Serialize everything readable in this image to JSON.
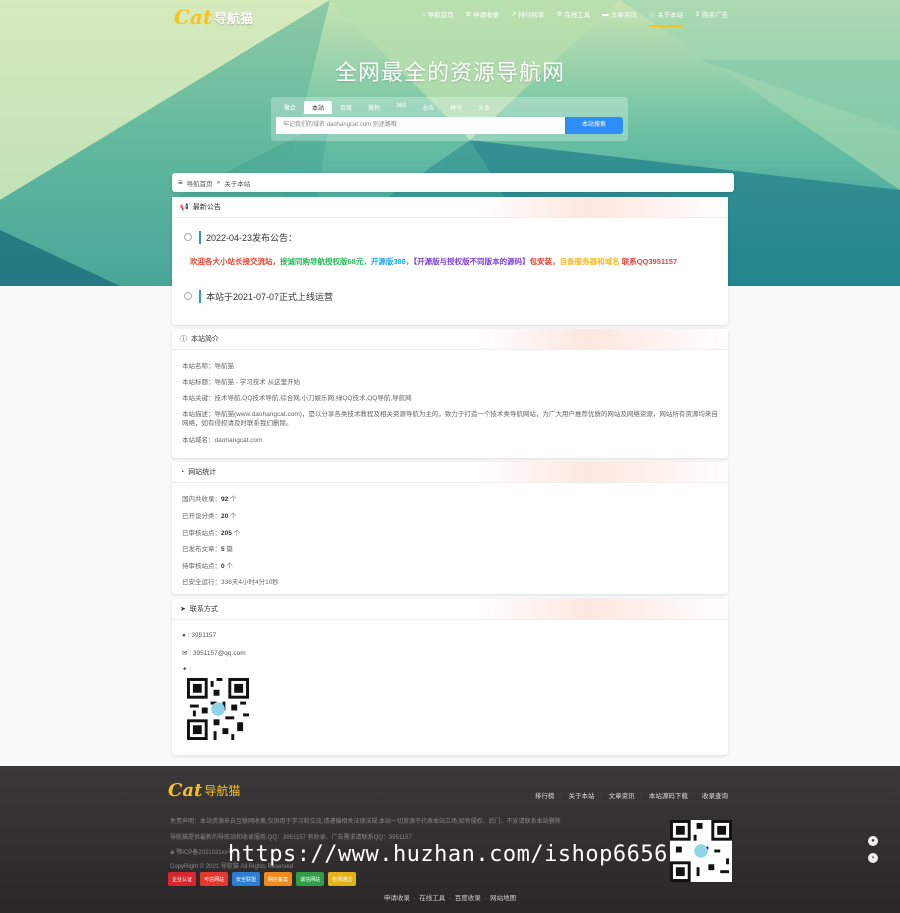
{
  "nav": {
    "logo_text": "导航猫",
    "items": [
      {
        "icon": "home-icon",
        "label": "导航首页",
        "active": false
      },
      {
        "icon": "add-site-icon",
        "label": "申请收录",
        "active": false
      },
      {
        "icon": "chart-icon",
        "label": "排行榜单",
        "active": false
      },
      {
        "icon": "tools-icon",
        "label": "在线工具",
        "active": false
      },
      {
        "icon": "folder-icon",
        "label": "文章资讯",
        "active": false
      },
      {
        "icon": "info-icon",
        "label": "关于本站",
        "active": true
      },
      {
        "icon": "cart-icon",
        "label": "购买广告",
        "active": false
      }
    ]
  },
  "hero": {
    "title": "全网最全的资源导航网"
  },
  "search": {
    "tabs": [
      "聚合",
      "本站",
      "百度",
      "搜狗",
      "360",
      "必应",
      "神马",
      "头条"
    ],
    "active_tab": "本站",
    "placeholder": "牢记我们的域名 daohangcat.com 别迷路哦",
    "button": "本站搜索"
  },
  "breadcrumb": {
    "home": "导航首页",
    "sep": "»",
    "current": "关于本站"
  },
  "notice": {
    "title": "最新公告",
    "items": [
      {
        "date_text": "2022-04-23发布公告："
      },
      {
        "date_text": "本站于2021-07-07正式上线运营"
      }
    ],
    "marquee": [
      {
        "text": "欢迎各大小站长接交流站，",
        "color": "#e8432e"
      },
      {
        "text": "接诚同购导航授权版68元，",
        "color": "#29b85b"
      },
      {
        "text": "开源版388，",
        "color": "#22a7f0"
      },
      {
        "text": "【开源版与授权版不同版本的源码】",
        "color": "#7b3ed8"
      },
      {
        "text": "包安装，",
        "color": "#e8432e"
      },
      {
        "text": "自备服务器和域名 ",
        "color": "#f7b924"
      },
      {
        "text": "联系QQ3951157",
        "color": "#e83e3e"
      }
    ]
  },
  "about": {
    "title": "本站简介",
    "lines": [
      "本站名称：导航猫",
      "本站标题：导航猫 - 学习技术 从这里开始",
      "本站关键：技术导航,QQ技术导航,综合网,小刀娱乐网,绿QQ技术,QQ导航,导航网",
      "本站描述：导航猫(www.daohangcat.com)，是以分享各类技术教程及相关资源导航为主的，致力于打造一个技术类导航网站，为广大用户推荐优质的网站及网络资源，网站所有资源均来自网络，如有侵权请及时联系我们删除。",
      "本站域名：daohangcat.com"
    ]
  },
  "stats": {
    "title": "网站统计",
    "rows": [
      {
        "label": "国内共收录：",
        "value": "92",
        "unit": " 个"
      },
      {
        "label": "已开设分类：",
        "value": "20",
        "unit": " 个"
      },
      {
        "label": "已审核站点：",
        "value": "205",
        "unit": " 个"
      },
      {
        "label": "已发布文章：",
        "value": "5",
        "unit": " 篇"
      },
      {
        "label": "待审核站点：",
        "value": "0",
        "unit": " 个"
      },
      {
        "label": "已安全运行：",
        "value": "",
        "unit": "336天4小时4分10秒"
      }
    ]
  },
  "contact": {
    "title": "联系方式",
    "qq": "3951157",
    "email": "3951157@qq.com"
  },
  "footer": {
    "logo_text": "导航猫",
    "links": [
      "排行榜",
      "关于本站",
      "文章资讯",
      "本站源码下载",
      "收录查询"
    ],
    "disclaimer": "免责声明：本站资源来自互联网收集,仅供用于学习和交流,请遵循相关法律法规,本站一切资源不代表本站立场,如有侵权、后门、不妥请联系本站删除",
    "line2": "导航猫提供最新的导航站和收录服务,QQ：3951157 有收录、广告需求请联系QQ：3951157",
    "icp": "鄂ICP备2021021xx号",
    "copyright": "CopyRight © 2021 导航猫 All Rights Reserved",
    "badges": [
      "企业认证",
      "可信网站",
      "安全联盟",
      "网信备案",
      "诚信网站",
      "检测通过"
    ],
    "bottom_links": [
      "申请收录",
      "在线工具",
      "百度收录",
      "网站地图"
    ],
    "watermark": "https://www.huzhan.com/ishop6656"
  }
}
